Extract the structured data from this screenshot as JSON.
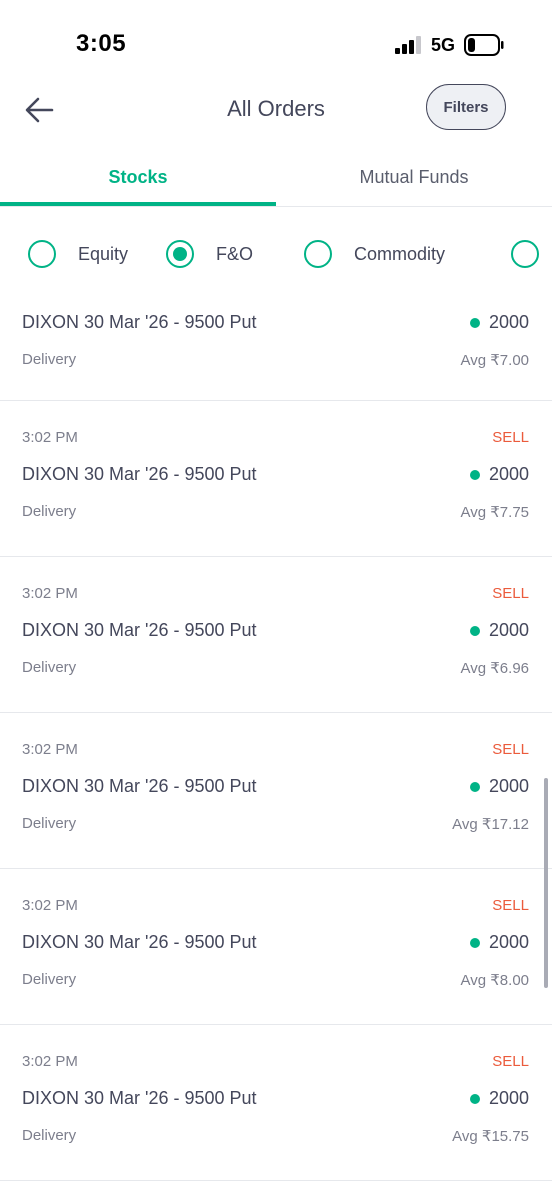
{
  "status_bar": {
    "time": "3:05",
    "network": "5G",
    "icons": [
      "cellular-signal-icon",
      "battery-icon"
    ]
  },
  "header": {
    "title": "All Orders",
    "filters_label": "Filters",
    "back_icon": "arrow-left-icon"
  },
  "tabs": {
    "stocks": "Stocks",
    "mutual_funds": "Mutual Funds",
    "active": "Stocks"
  },
  "segments": {
    "equity": "Equity",
    "fno": "F&O",
    "commodity": "Commodity",
    "selected": "F&O"
  },
  "colors": {
    "accent": "#00b386",
    "sell": "#eb5b3c",
    "text": "#44475b",
    "muted": "#7c7e8c"
  },
  "orders": [
    {
      "name": "DIXON 30 Mar '26 - 9500 Put",
      "qty": "2000",
      "product": "Delivery",
      "avg": "Avg ₹7.00"
    },
    {
      "time": "3:02 PM",
      "side": "SELL",
      "name": "DIXON 30 Mar '26 - 9500 Put",
      "qty": "2000",
      "product": "Delivery",
      "avg": "Avg ₹7.75"
    },
    {
      "time": "3:02 PM",
      "side": "SELL",
      "name": "DIXON 30 Mar '26 - 9500 Put",
      "qty": "2000",
      "product": "Delivery",
      "avg": "Avg ₹6.96"
    },
    {
      "time": "3:02 PM",
      "side": "SELL",
      "name": "DIXON 30 Mar '26 - 9500 Put",
      "qty": "2000",
      "product": "Delivery",
      "avg": "Avg ₹17.12"
    },
    {
      "time": "3:02 PM",
      "side": "SELL",
      "name": "DIXON 30 Mar '26 - 9500 Put",
      "qty": "2000",
      "product": "Delivery",
      "avg": "Avg ₹8.00"
    },
    {
      "time": "3:02 PM",
      "side": "SELL",
      "name": "DIXON 30 Mar '26 - 9500 Put",
      "qty": "2000",
      "product": "Delivery",
      "avg": "Avg ₹15.75"
    }
  ]
}
